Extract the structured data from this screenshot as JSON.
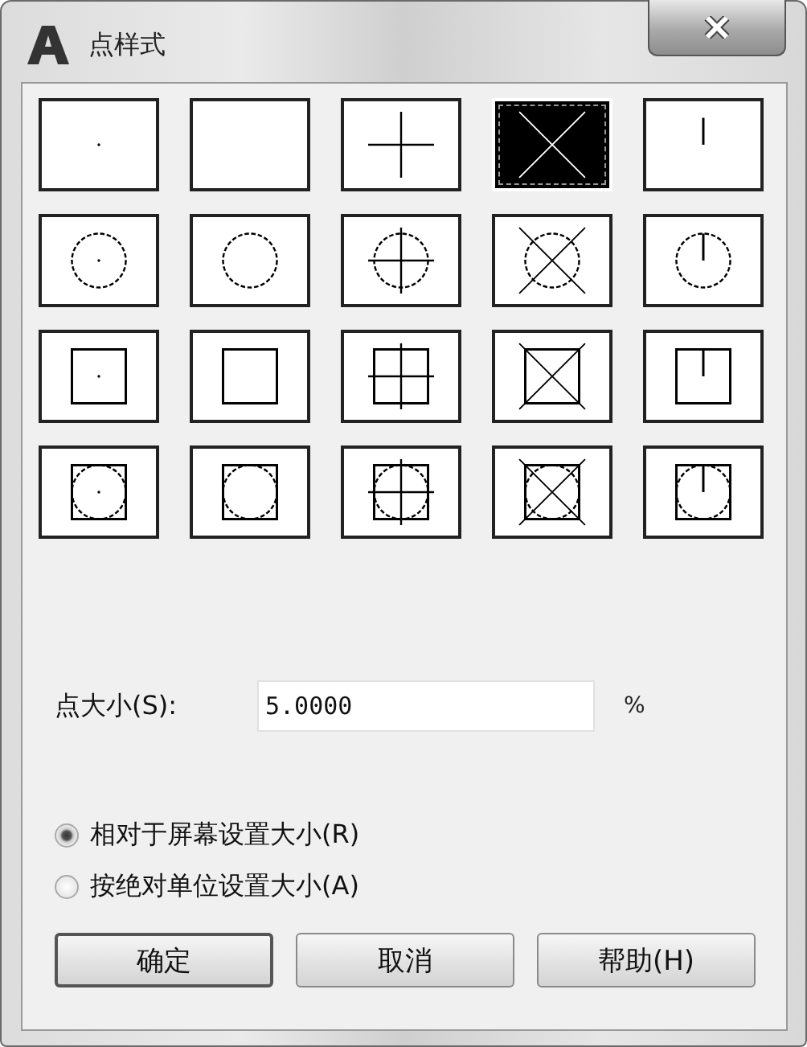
{
  "window": {
    "title": "点样式"
  },
  "point_styles": [
    {
      "kind": "dot",
      "selected": false
    },
    {
      "kind": "blank",
      "selected": false
    },
    {
      "kind": "plus",
      "selected": false
    },
    {
      "kind": "cross",
      "selected": true
    },
    {
      "kind": "tick",
      "selected": false
    },
    {
      "kind": "circle-dot",
      "selected": false
    },
    {
      "kind": "circle",
      "selected": false
    },
    {
      "kind": "circle-plus",
      "selected": false
    },
    {
      "kind": "circle-cross",
      "selected": false
    },
    {
      "kind": "circle-tick",
      "selected": false
    },
    {
      "kind": "square-dot",
      "selected": false
    },
    {
      "kind": "square",
      "selected": false
    },
    {
      "kind": "square-plus",
      "selected": false
    },
    {
      "kind": "square-cross",
      "selected": false
    },
    {
      "kind": "square-tick",
      "selected": false
    },
    {
      "kind": "both-dot",
      "selected": false
    },
    {
      "kind": "both",
      "selected": false
    },
    {
      "kind": "both-plus",
      "selected": false
    },
    {
      "kind": "both-cross",
      "selected": false
    },
    {
      "kind": "both-tick",
      "selected": false
    }
  ],
  "size": {
    "label": "点大小(S):",
    "value": "5.0000",
    "unit": "%"
  },
  "size_modes": [
    {
      "label": "相对于屏幕设置大小(R)",
      "selected": true
    },
    {
      "label": "按绝对单位设置大小(A)",
      "selected": false
    }
  ],
  "buttons": [
    {
      "label": "确定",
      "default": true
    },
    {
      "label": "取消",
      "default": false
    },
    {
      "label": "帮助(H)",
      "default": false
    }
  ]
}
